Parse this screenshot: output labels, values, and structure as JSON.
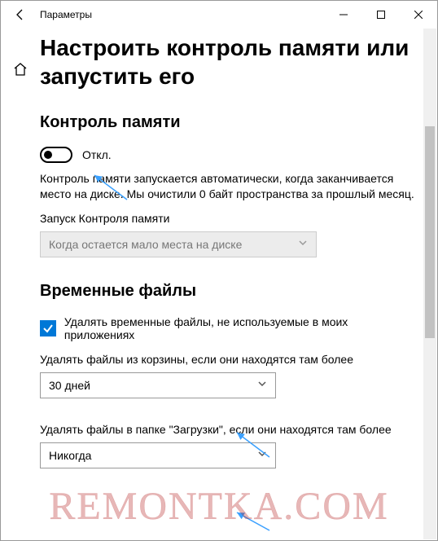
{
  "window": {
    "title": "Параметры"
  },
  "page": {
    "title": "Настроить контроль памяти или запустить его"
  },
  "storage_sense": {
    "heading": "Контроль памяти",
    "toggle_state": "Откл.",
    "description": "Контроль памяти запускается автоматически, когда заканчивается место на диске. Мы очистили 0 байт пространства за прошлый месяц.",
    "run_label": "Запуск Контроля памяти",
    "run_dropdown": "Когда остается мало места на диске"
  },
  "temp_files": {
    "heading": "Временные файлы",
    "checkbox_label": "Удалять временные файлы, не используемые в моих приложениях",
    "recycle_label": "Удалять файлы из корзины, если они находятся там более",
    "recycle_value": "30 дней",
    "downloads_label": "Удалять файлы в папке \"Загрузки\", если они находятся там более",
    "downloads_value": "Никогда"
  },
  "watermark": "REMONTKA.COM"
}
